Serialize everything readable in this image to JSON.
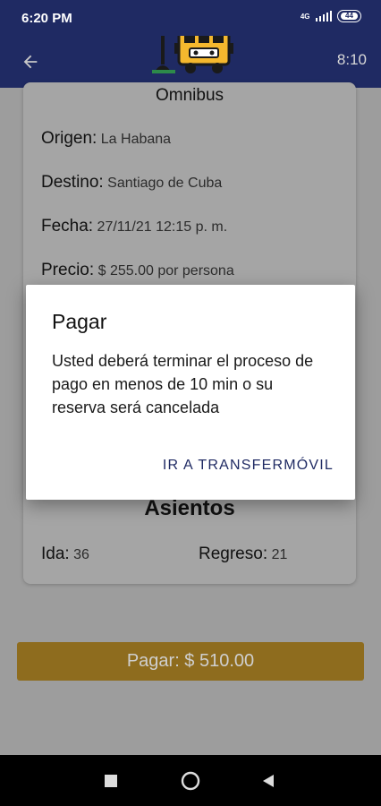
{
  "status_bar": {
    "time": "6:20 PM",
    "network": "4G",
    "battery": "44"
  },
  "app_bar": {
    "timer": "8:10",
    "back_icon": "arrow-left-icon",
    "logo_icon": "bus-logo-icon"
  },
  "trip": {
    "title": "Omnibus",
    "origin": {
      "label": "Origen:",
      "value": "La Habana"
    },
    "destination": {
      "label": "Destino:",
      "value": "Santiago de Cuba"
    },
    "date": {
      "label": "Fecha:",
      "value": "27/11/21 12:15 p. m."
    },
    "price": {
      "label": "Precio:",
      "value": "$ 255.00 por persona"
    }
  },
  "seats": {
    "title": "Asientos",
    "outbound": {
      "label": "Ida:",
      "value": "36"
    },
    "return": {
      "label": "Regreso:",
      "value": "21"
    }
  },
  "pay_button": {
    "label": "Pagar: $ 510.00"
  },
  "dialog": {
    "title": "Pagar",
    "message": "Usted deberá terminar el proceso de pago en menos de 10 min o su reserva será cancelada",
    "action_label": "IR A TRANSFERMÓVIL"
  },
  "nav": {
    "recent_icon": "square-icon",
    "home_icon": "circle-icon",
    "back_icon": "triangle-back-icon"
  },
  "colors": {
    "primary": "#1f2a63",
    "accent": "#f5b82e",
    "scrim": "#000000"
  }
}
